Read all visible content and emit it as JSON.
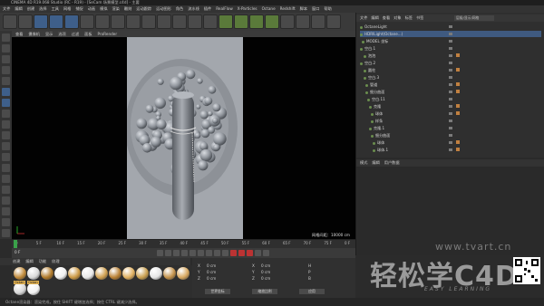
{
  "window": {
    "title": "CINEMA 4D R19.068 Studio (RC - R19) - [SeCam 场景模型.c4d] - 主要"
  },
  "menubar": {
    "items": [
      "文件",
      "编辑",
      "创建",
      "选择",
      "工具",
      "网格",
      "捕捉",
      "动画",
      "模拟",
      "渲染",
      "雕刻",
      "运动跟踪",
      "运动图形",
      "角色",
      "流水线",
      "插件",
      "RealFlow",
      "X-Particles",
      "Octane",
      "Redshift",
      "脚本",
      "窗口",
      "帮助"
    ]
  },
  "viewport": {
    "menu": [
      "查看",
      "摄像机",
      "显示",
      "选项",
      "过滤",
      "面板",
      "ProRender"
    ],
    "grid_label": "网格间距：10000 cm"
  },
  "timeline": {
    "ticks": [
      "0",
      "5 F",
      "10 F",
      "15 F",
      "20 F",
      "25 F",
      "30 F",
      "35 F",
      "40 F",
      "45 F",
      "50 F",
      "55 F",
      "60 F",
      "65 F",
      "70 F",
      "75 F",
      "0 F"
    ],
    "current_frame": "0 F"
  },
  "materials": {
    "menu": [
      "创建",
      "编辑",
      "功能",
      "纹理"
    ],
    "labels": [
      "Octan",
      "Octan"
    ]
  },
  "attributes": {
    "axes": [
      "X",
      "Y",
      "Z"
    ],
    "values": [
      "0 cm",
      "0 cm",
      "0 cm"
    ],
    "h": [
      "H",
      "P",
      "B"
    ],
    "buttons": [
      "世界坐标",
      "缩放比例",
      "应用"
    ]
  },
  "object_manager": {
    "menu": [
      "文件",
      "编辑",
      "查看",
      "对象",
      "标签",
      "书签"
    ],
    "search": "层级/显示/网格",
    "rows": [
      {
        "label": "OctaneLight"
      },
      {
        "label": "HDRILight(Octane...)"
      },
      {
        "label": "MODEL 坐标"
      },
      {
        "label": "空白.1"
      },
      {
        "label": "泡泡"
      },
      {
        "label": "空白.2"
      },
      {
        "label": "圆柱"
      },
      {
        "label": "空白.3"
      },
      {
        "label": "管道"
      },
      {
        "label": "细分曲面"
      },
      {
        "label": "空白.11"
      },
      {
        "label": "克隆"
      },
      {
        "label": "球体"
      },
      {
        "label": "样条"
      },
      {
        "label": "克隆.1"
      },
      {
        "label": "细分曲面"
      },
      {
        "label": "球体"
      },
      {
        "label": "球体.1"
      }
    ]
  },
  "attribute_manager": {
    "menu": [
      "模式",
      "编辑",
      "用户数据"
    ]
  },
  "status": {
    "text": "Octane渲染器：渲染完成，按住 SHIFT 键增加选择；按住 CTRL 键减少选择。"
  },
  "watermark": {
    "url": "www.tvart.cn",
    "logo": "轻松学C4D",
    "subtitle": "EASY LEARNING"
  }
}
